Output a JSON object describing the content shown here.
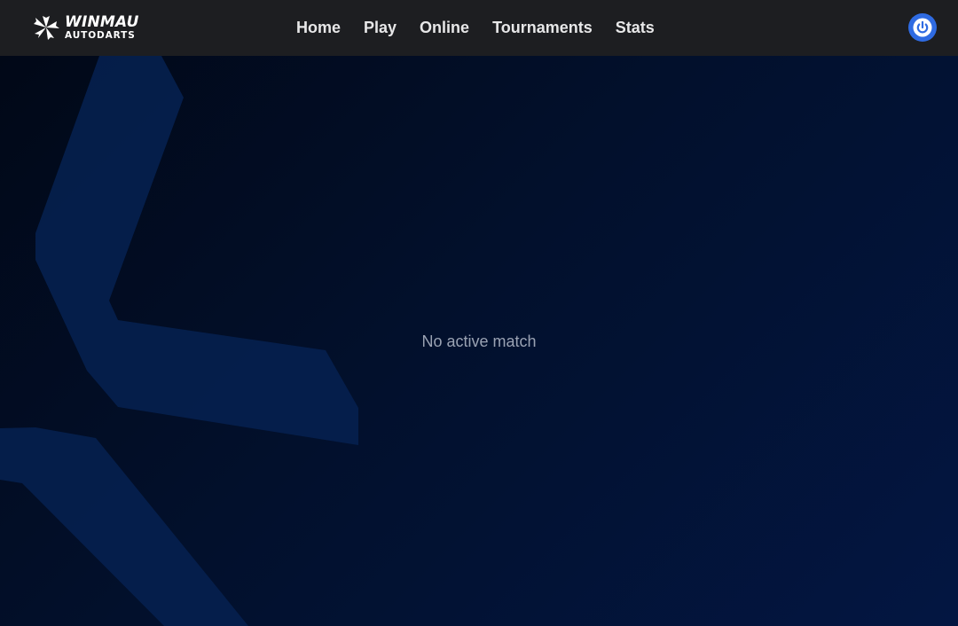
{
  "brand": {
    "name": "WINMAU",
    "subtitle": "AUTODARTS"
  },
  "nav": {
    "items": [
      {
        "label": "Home"
      },
      {
        "label": "Play"
      },
      {
        "label": "Online"
      },
      {
        "label": "Tournaments"
      },
      {
        "label": "Stats"
      }
    ]
  },
  "header": {
    "power_icon": "power-icon"
  },
  "main": {
    "empty_message": "No active match"
  },
  "colors": {
    "topbar": "#1d1e21",
    "accent": "#2f6be2",
    "background_dark": "#010817",
    "background_blue": "#031642",
    "shape_blue": "#06204f"
  }
}
